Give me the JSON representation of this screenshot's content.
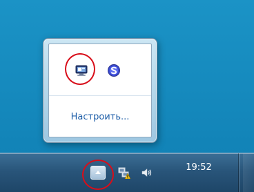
{
  "popup": {
    "configure_label": "Настроить...",
    "icons": [
      {
        "name": "scanner-monitor-icon",
        "highlighted": true
      },
      {
        "name": "scansnap-s-icon",
        "highlighted": false
      }
    ]
  },
  "taskbar": {
    "show_hidden_icons": {
      "icon": "chevron-up-icon",
      "highlighted": true
    },
    "icons": [
      "network-warning-icon",
      "volume-icon"
    ],
    "clock_time": "19:52"
  },
  "colors": {
    "highlight": "#d80e1a",
    "link": "#1e5ea8",
    "desktop": "#1487bb",
    "taskbar": "#29557a"
  }
}
